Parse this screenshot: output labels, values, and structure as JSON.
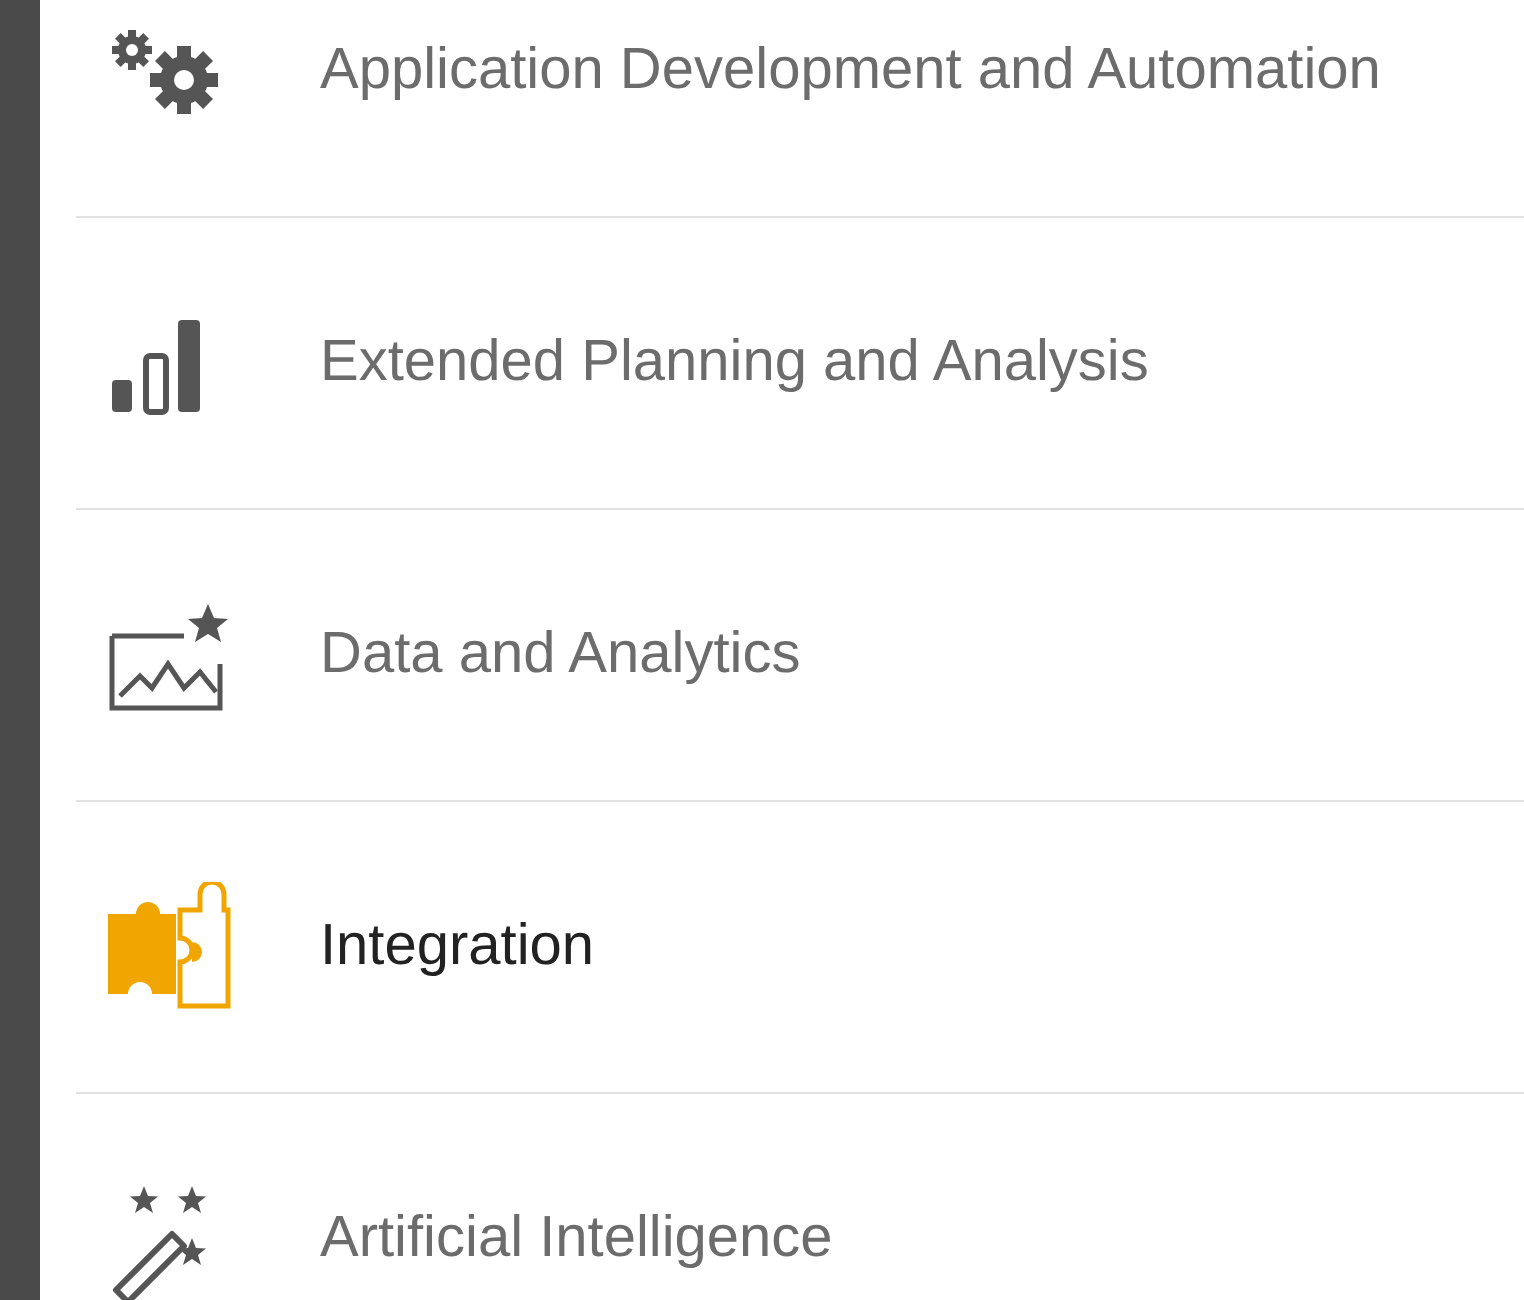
{
  "menu": {
    "items": [
      {
        "label": "Application Development and Automation",
        "selected": false
      },
      {
        "label": "Extended Planning and Analysis",
        "selected": false
      },
      {
        "label": "Data and Analytics",
        "selected": false
      },
      {
        "label": "Integration",
        "selected": true
      },
      {
        "label": "Artificial Intelligence",
        "selected": false
      }
    ]
  }
}
